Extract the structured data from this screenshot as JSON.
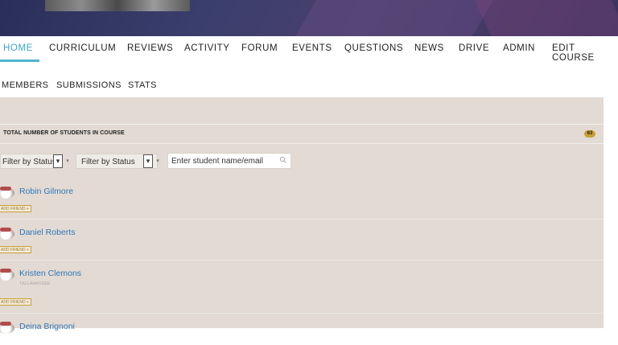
{
  "nav": {
    "items": [
      "HOME",
      "CURRICULUM",
      "REVIEWS",
      "ACTIVITY",
      "FORUM",
      "EVENTS",
      "QUESTIONS",
      "NEWS",
      "DRIVE",
      "ADMIN",
      "EDIT COURSE"
    ],
    "active_color": "#3aa3c7"
  },
  "subnav": {
    "items": [
      "MEMBERS",
      "SUBMISSIONS",
      "STATS"
    ]
  },
  "summary": {
    "label": "TOTAL NUMBER OF STUDENTS IN COURSE",
    "count": "63",
    "badge_color": "#c9a032"
  },
  "filters": [
    {
      "label": "Filter by Status"
    },
    {
      "label": "Filter by Status"
    }
  ],
  "search": {
    "placeholder": "Enter student name/email"
  },
  "members": [
    {
      "name": "Robin Gilmore",
      "action": "ADD FRIEND +"
    },
    {
      "name": "Daniel Roberts",
      "action": "ADD FRIEND +"
    },
    {
      "name": "Kristen Clemons",
      "subtitle": "TALLAHASSEE",
      "action": "ADD FRIEND +"
    },
    {
      "name": "Deina Brignoni"
    }
  ],
  "colors": {
    "content_bg": "#e2dad3",
    "link": "#2f77b8",
    "accent": "#4fb3d0"
  }
}
